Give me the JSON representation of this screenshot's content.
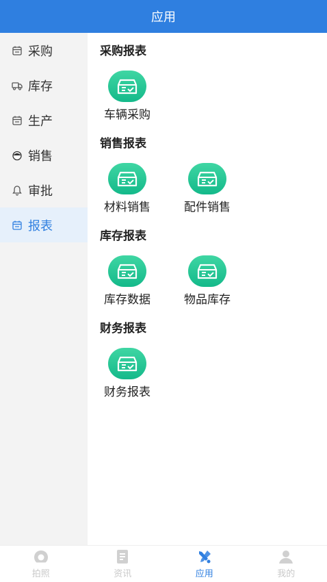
{
  "header": {
    "title": "应用"
  },
  "sidebar": {
    "items": [
      {
        "label": "采购",
        "icon": "calendar-icon"
      },
      {
        "label": "库存",
        "icon": "truck-icon"
      },
      {
        "label": "生产",
        "icon": "calendar-icon"
      },
      {
        "label": "销售",
        "icon": "person-icon"
      },
      {
        "label": "审批",
        "icon": "bell-icon"
      },
      {
        "label": "报表",
        "icon": "calendar-icon",
        "active": true
      }
    ]
  },
  "sections": [
    {
      "title": "采购报表",
      "tiles": [
        {
          "label": "车辆采购",
          "icon": "report-box-icon"
        }
      ]
    },
    {
      "title": "销售报表",
      "tiles": [
        {
          "label": "材料销售",
          "icon": "report-box-icon"
        },
        {
          "label": "配件销售",
          "icon": "report-box-icon"
        }
      ]
    },
    {
      "title": "库存报表",
      "tiles": [
        {
          "label": "库存数据",
          "icon": "report-box-icon"
        },
        {
          "label": "物品库存",
          "icon": "report-box-icon"
        }
      ]
    },
    {
      "title": "财务报表",
      "tiles": [
        {
          "label": "财务报表",
          "icon": "report-box-icon"
        }
      ]
    }
  ],
  "tabbar": {
    "items": [
      {
        "label": "拍照",
        "icon": "camera-icon"
      },
      {
        "label": "资讯",
        "icon": "news-icon"
      },
      {
        "label": "应用",
        "icon": "tools-icon",
        "active": true
      },
      {
        "label": "我的",
        "icon": "user-icon"
      }
    ]
  },
  "colors": {
    "primary": "#2f7fe0",
    "tile_green": "#14b98a",
    "sidebar_bg": "#f3f3f3",
    "sidebar_active_bg": "#e6f0fb",
    "tab_inactive": "#c9c9c9"
  }
}
